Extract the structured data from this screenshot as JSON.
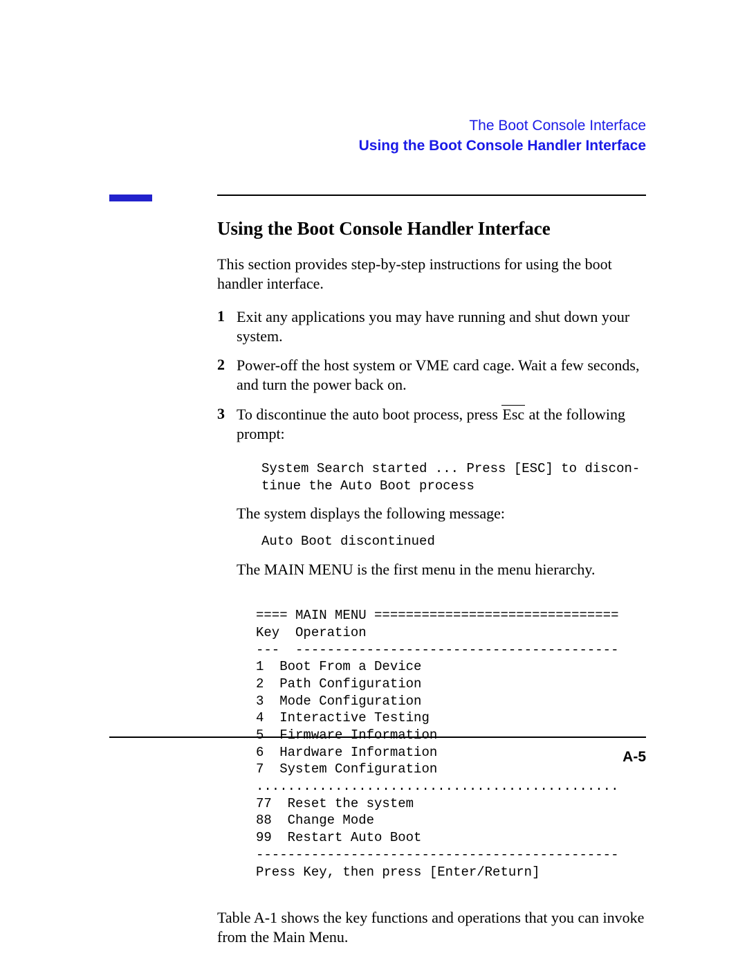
{
  "header": {
    "chapter": "The Boot Console Interface",
    "section": "Using the Boot Console Handler Interface"
  },
  "heading": "Using the Boot Console Handler Interface",
  "intro": "This section provides step-by-step instructions for using the boot handler interface.",
  "steps": [
    {
      "num": "1",
      "text": "Exit any applications you may have running and shut down your system."
    },
    {
      "num": "2",
      "text": "Power-off the host system or VME card cage. Wait a few seconds, and turn the power back on."
    },
    {
      "num": "3",
      "text_before_key": "To discontinue the auto boot process, press ",
      "key": "Esc",
      "text_after_key": " at the following prompt:"
    }
  ],
  "code1": "System Search started ... Press [ESC] to discon-\ntinue the Auto Boot process",
  "sub1": "The system displays the following message:",
  "code2": "Auto Boot discontinued",
  "sub2": "The MAIN MENU is the first menu in the menu hierarchy.",
  "menu": "==== MAIN MENU ===============================\nKey  Operation\n---  -----------------------------------------\n1  Boot From a Device\n2  Path Configuration\n3  Mode Configuration\n4  Interactive Testing\n5  Firmware Information\n6  Hardware Information\n7  System Configuration\n..............................................\n77  Reset the system\n88  Change Mode\n99  Restart Auto Boot\n----------------------------------------------\nPress Key, then press [Enter/Return]",
  "closing": "Table A-1 shows the key functions and operations that you can invoke from the Main Menu.",
  "pageNumber": "A-5"
}
